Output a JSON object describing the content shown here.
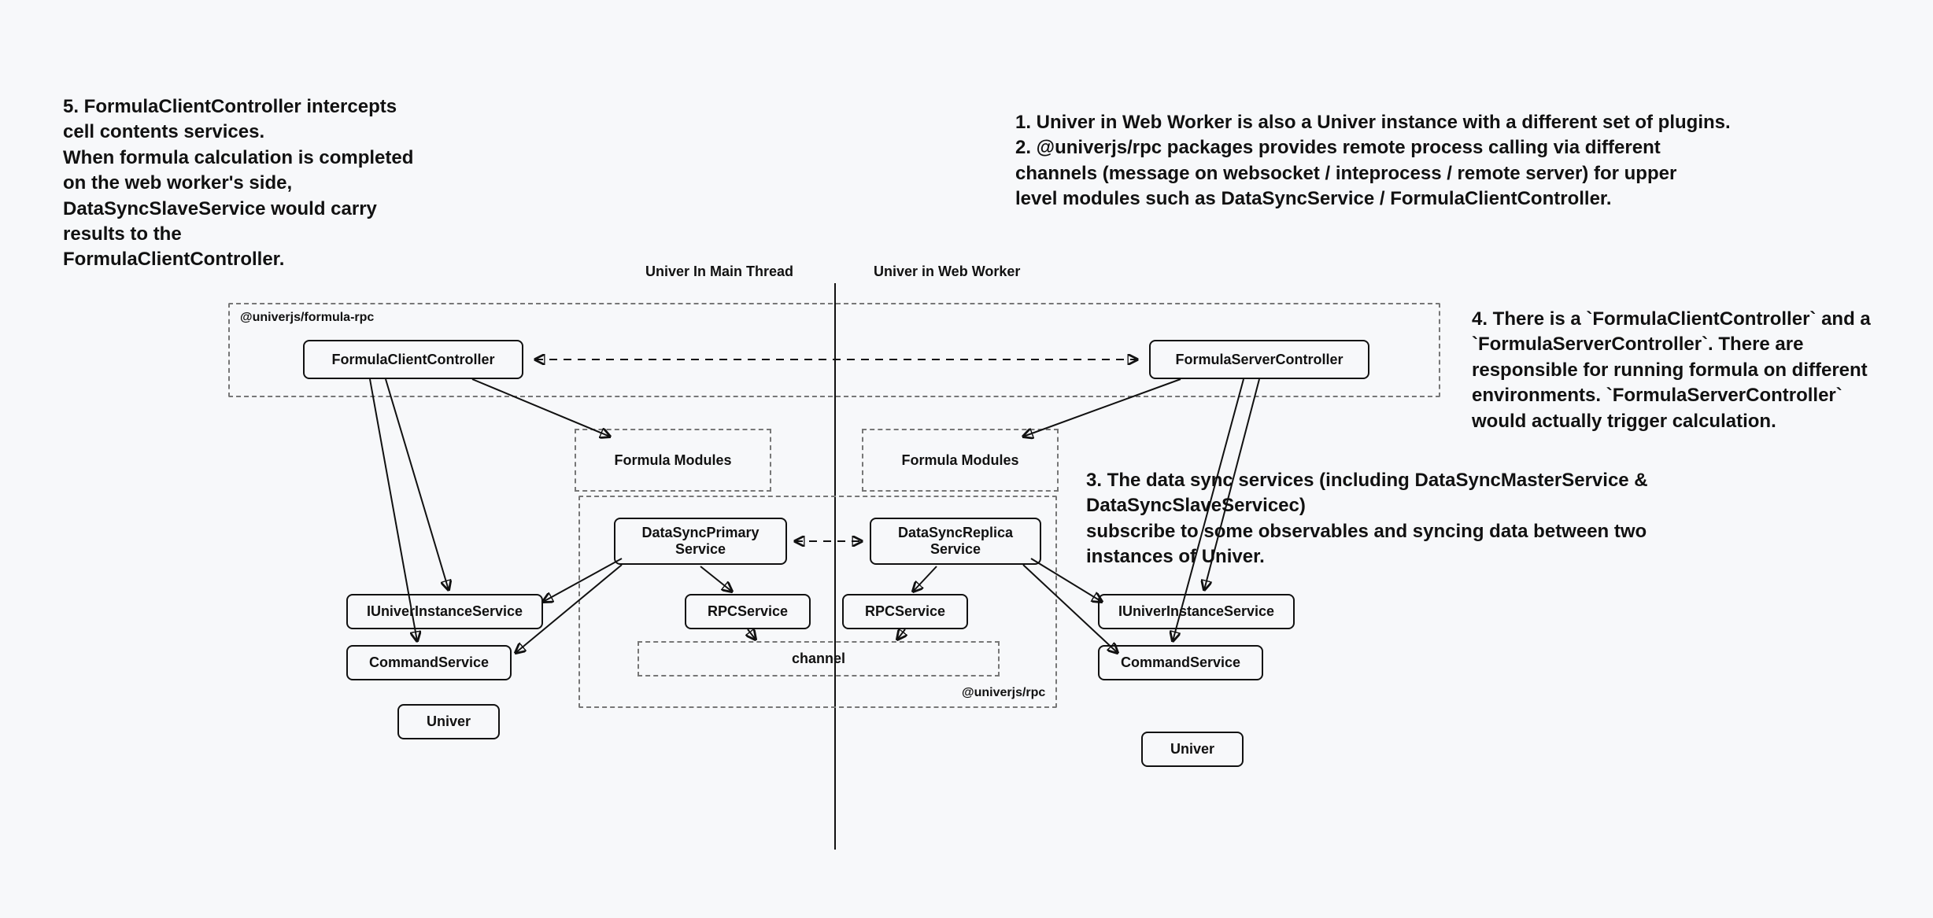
{
  "annotations": {
    "note5": "5. FormulaClientController intercepts\ncell contents services.\nWhen formula calculation is completed\non the web worker's side,\nDataSyncSlaveService would carry\nresults to the\nFormulaClientController.",
    "note12": "1. Univer in Web Worker is also a Univer instance with a different set of plugins.\n2. @univerjs/rpc packages provides remote process calling via different\nchannels (message on websocket / inteprocess / remote server) for upper\nlevel modules such as DataSyncService / FormulaClientController.",
    "note4": "4. There is a `FormulaClientController` and a\n`FormulaServerController`. There are\nresponsible for running formula on different\nenvironments. `FormulaServerController`\nwould actually trigger calculation.",
    "note3": "3. The data sync services (including DataSyncMasterService &\nDataSyncSlaveServicec)\nsubscribe to some observables and syncing data between two\ninstances of Univer."
  },
  "columns": {
    "left": "Univer In Main Thread",
    "right": "Univer in Web Worker"
  },
  "groups": {
    "formula_rpc_label": "@univerjs/formula-rpc",
    "rpc_label": "@univerjs/rpc"
  },
  "nodes": {
    "formula_client": "FormulaClientController",
    "formula_server": "FormulaServerController",
    "formula_modules_l": "Formula Modules",
    "formula_modules_r": "Formula Modules",
    "data_sync_primary": "DataSyncPrimary\nService",
    "data_sync_replica": "DataSyncReplica\nService",
    "rpc_service_l": "RPCService",
    "rpc_service_r": "RPCService",
    "channel": "channel",
    "iuniver_l": "IUniverInstanceService",
    "iuniver_r": "IUniverInstanceService",
    "command_l": "CommandService",
    "command_r": "CommandService",
    "univer_l": "Univer",
    "univer_r": "Univer"
  }
}
